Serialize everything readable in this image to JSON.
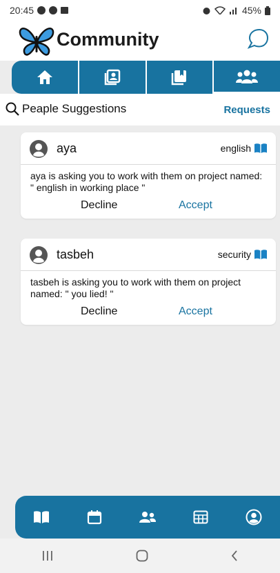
{
  "status_bar": {
    "time": "20:45",
    "battery": "45%"
  },
  "header": {
    "title": "Community"
  },
  "top_tabs": [
    {
      "icon": "home-icon"
    },
    {
      "icon": "contact-book-icon"
    },
    {
      "icon": "bookmark-icon"
    },
    {
      "icon": "users-icon",
      "active": true
    }
  ],
  "subheader": {
    "suggestions_label": "Peaple Suggestions",
    "requests_label": "Requests"
  },
  "requests": [
    {
      "user": "aya",
      "category": "english",
      "message": "aya is asking you to work with them on project named: \" english in working place \"",
      "decline_label": "Decline",
      "accept_label": "Accept"
    },
    {
      "user": "tasbeh",
      "category": "security",
      "message": "tasbeh is asking you to work with them on project named: \" you lied! \"",
      "decline_label": "Decline",
      "accept_label": "Accept"
    }
  ],
  "bottom_nav": [
    {
      "icon": "book-icon"
    },
    {
      "icon": "calendar-icon"
    },
    {
      "icon": "people-icon"
    },
    {
      "icon": "table-icon"
    },
    {
      "icon": "profile-icon"
    }
  ],
  "colors": {
    "accent": "#1873a0",
    "background": "#ececec",
    "card": "#ffffff"
  }
}
